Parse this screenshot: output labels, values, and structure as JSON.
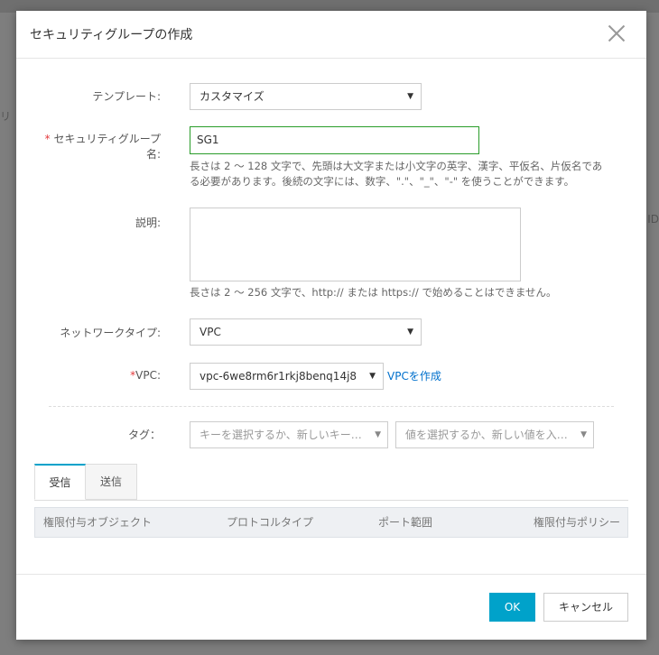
{
  "background": {
    "left_fragment": "リ",
    "right_fragment": "ID"
  },
  "modal": {
    "title": "セキュリティグループの作成",
    "close_icon": "close-icon"
  },
  "form": {
    "template": {
      "label": "テンプレート:",
      "value": "カスタマイズ"
    },
    "group_name": {
      "required_mark": "*",
      "label_line1": "セキュリティグループ",
      "label_line2": "名:",
      "value": "SG1",
      "help_line1": "長さは 2 ～ 128 文字で、先頭は大文字または小文字の英字、漢字、平仮名、片仮名であ",
      "help_line2": "る必要があります。後続の文字には、数字、\".\"、\"_\"、\"-\" を使うことができます。"
    },
    "description": {
      "label": "説明:",
      "value": "",
      "help": "長さは 2 ～ 256 文字で、http:// または https:// で始めることはできません。"
    },
    "network_type": {
      "label": "ネットワークタイプ:",
      "value": "VPC"
    },
    "vpc": {
      "required_mark": "*",
      "label": "VPC:",
      "value": "vpc-6we8rm6r1rkj8benq14j8",
      "create_link": "VPCを作成"
    },
    "tag": {
      "label": "タグ：",
      "key_placeholder": "キーを選択するか、新しいキー…",
      "value_placeholder": "値を選択するか、新しい値を入…"
    }
  },
  "tabs": [
    {
      "label": "受信",
      "active": true
    },
    {
      "label": "送信",
      "active": false
    }
  ],
  "table": {
    "columns": [
      "権限付与オブジェクト",
      "プロトコルタイプ",
      "ポート範囲",
      "権限付与ポリシー"
    ]
  },
  "footer": {
    "ok_label": "OK",
    "cancel_label": "キャンセル"
  },
  "colors": {
    "primary": "#00a2ca",
    "link": "#0070cc",
    "required": "#e4393c",
    "valid_border": "#2a9c2a"
  }
}
